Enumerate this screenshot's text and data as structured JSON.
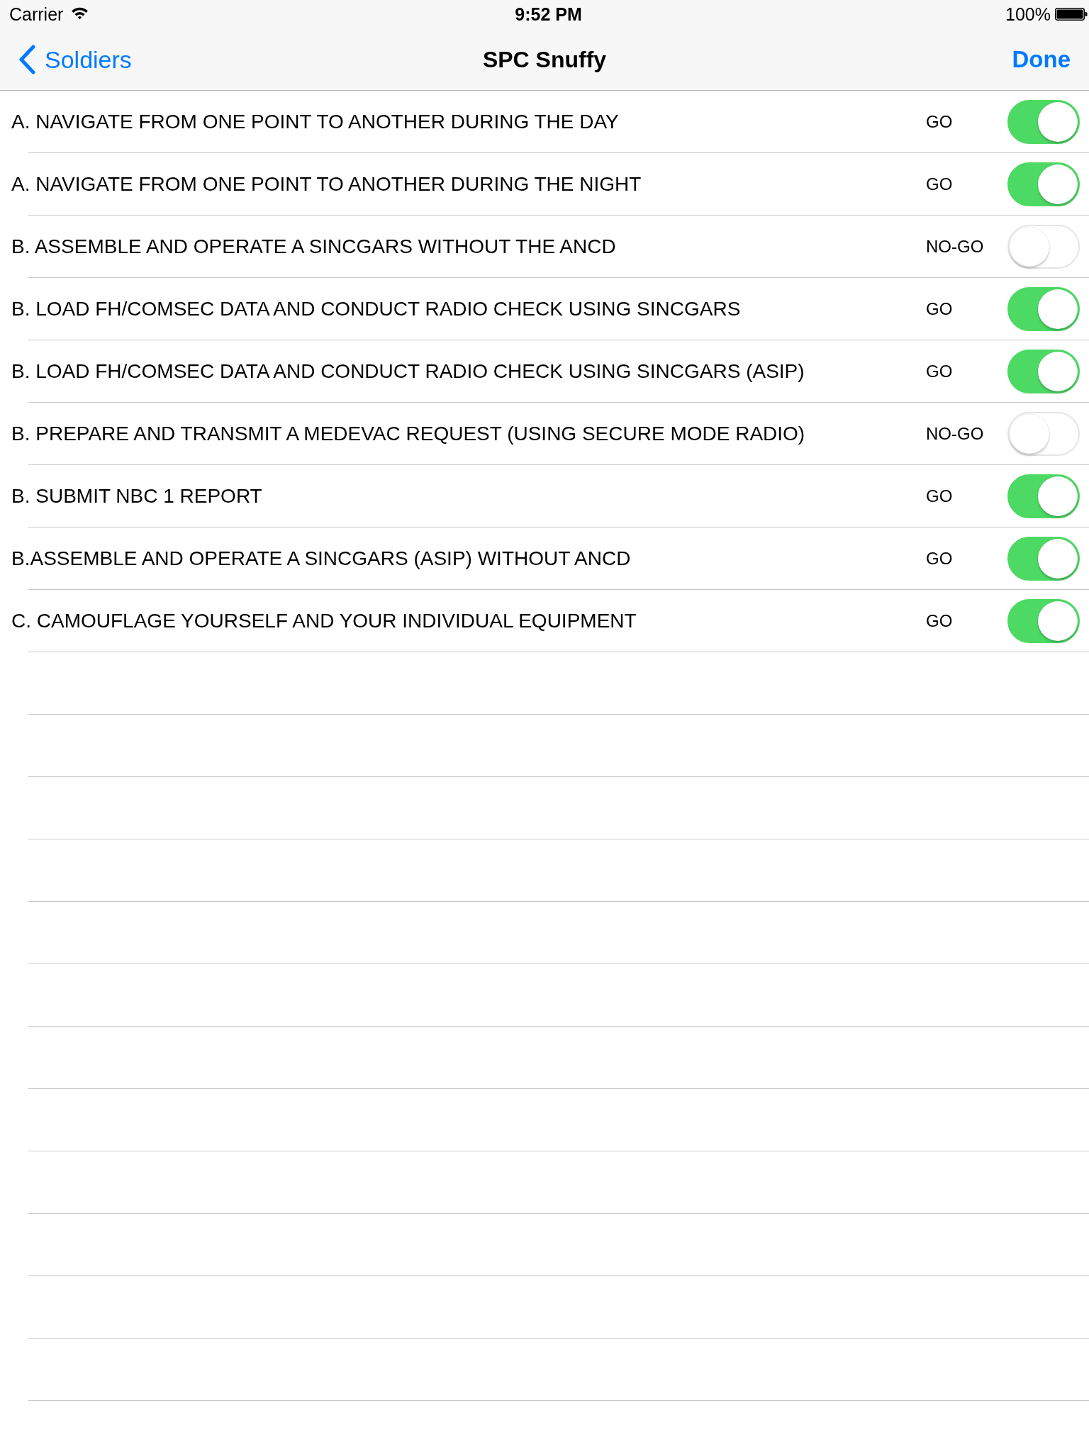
{
  "status_bar": {
    "carrier": "Carrier",
    "time": "9:52 PM",
    "battery": "100%"
  },
  "nav_bar": {
    "back": "Soldiers",
    "title": "SPC Snuffy",
    "action": "Done"
  },
  "rows": [
    {
      "task": "A. NAVIGATE FROM ONE POINT TO ANOTHER DURING THE DAY",
      "result": "GO",
      "on": true
    },
    {
      "task": "A. NAVIGATE FROM ONE POINT TO ANOTHER DURING THE NIGHT",
      "result": "GO",
      "on": true
    },
    {
      "task": "B. ASSEMBLE AND OPERATE A SINCGARS WITHOUT THE ANCD",
      "result": "NO-GO",
      "on": false
    },
    {
      "task": "B. LOAD FH/COMSEC DATA AND CONDUCT RADIO CHECK USING SINCGARS",
      "result": "GO",
      "on": true
    },
    {
      "task": "B. LOAD FH/COMSEC DATA AND CONDUCT RADIO CHECK USING SINCGARS (ASIP)",
      "result": "GO",
      "on": true
    },
    {
      "task": "B. PREPARE AND TRANSMIT A MEDEVAC REQUEST (USING SECURE MODE RADIO)",
      "result": "NO-GO",
      "on": false
    },
    {
      "task": "B. SUBMIT NBC 1 REPORT",
      "result": "GO",
      "on": true
    },
    {
      "task": "B.ASSEMBLE AND OPERATE A SINCGARS (ASIP) WITHOUT ANCD",
      "result": "GO",
      "on": true
    },
    {
      "task": "C. CAMOUFLAGE YOURSELF AND YOUR INDIVIDUAL EQUIPMENT",
      "result": "GO",
      "on": true
    }
  ]
}
